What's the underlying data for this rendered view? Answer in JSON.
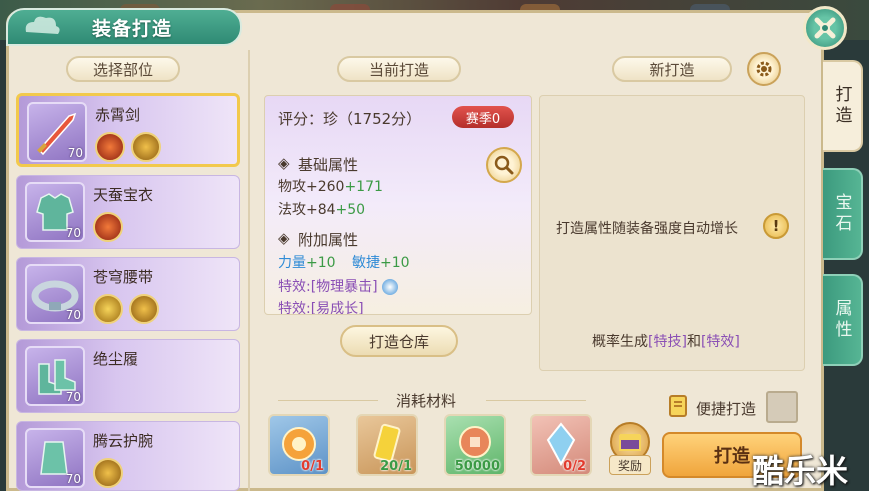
{
  "window": {
    "title": "装备打造"
  },
  "left": {
    "section_label": "选择部位"
  },
  "items": [
    {
      "name": "赤霄剑",
      "level": "70",
      "selected": true
    },
    {
      "name": "天蚕宝衣",
      "level": "70",
      "selected": false
    },
    {
      "name": "苍穹腰带",
      "level": "70",
      "selected": false
    },
    {
      "name": "绝尘履",
      "level": "70",
      "selected": false
    },
    {
      "name": "腾云护腕",
      "level": "70",
      "selected": false
    }
  ],
  "current": {
    "section_label": "当前打造",
    "score": "评分：珍（1752分）",
    "season_badge": "赛季0",
    "base_title": "基础属性",
    "base_attrs": [
      {
        "name": "物攻",
        "base": "+260",
        "bonus": "+171"
      },
      {
        "name": "法攻",
        "base": "+84",
        "bonus": "+50"
      }
    ],
    "extra_title": "附加属性",
    "extra_attrs": [
      {
        "name": "力量",
        "value": "+10"
      },
      {
        "name": "敏捷",
        "value": "+10"
      }
    ],
    "effect_label": "特效:",
    "effects": [
      "[物理暴击]",
      "[易成长]"
    ],
    "warehouse_button": "打造仓库"
  },
  "new": {
    "section_label": "新打造",
    "info_text": "打造属性随装备强度自动增长",
    "prob_prefix": "概率生成",
    "prob_skill": "[特技]",
    "prob_and": "和",
    "prob_effect": "[特效]"
  },
  "materials": {
    "section_label": "消耗材料",
    "items": [
      {
        "icon": "orb-icon",
        "count": "0/1",
        "color": "#e23b2e"
      },
      {
        "icon": "scroll-icon",
        "count": "20/1",
        "color": "#3b9a45"
      },
      {
        "icon": "coin-icon",
        "count": "50000",
        "color": "#3b9a45"
      },
      {
        "icon": "crystal-icon",
        "count": "0/2",
        "color": "#e23b2e"
      }
    ],
    "reward_label": "奖励"
  },
  "quick_forge": {
    "label": "便捷打造"
  },
  "forge_button": "打造",
  "side_tabs": [
    {
      "label": "打造",
      "active": true
    },
    {
      "label": "宝石",
      "active": false
    },
    {
      "label": "属性",
      "active": false
    }
  ],
  "watermark": "酷乐米",
  "colors": {
    "accent": "#2f8a74",
    "bonus_green": "#3b9a45",
    "extra_blue": "#2f8bd6",
    "effect_purple": "#8a4fb5"
  }
}
